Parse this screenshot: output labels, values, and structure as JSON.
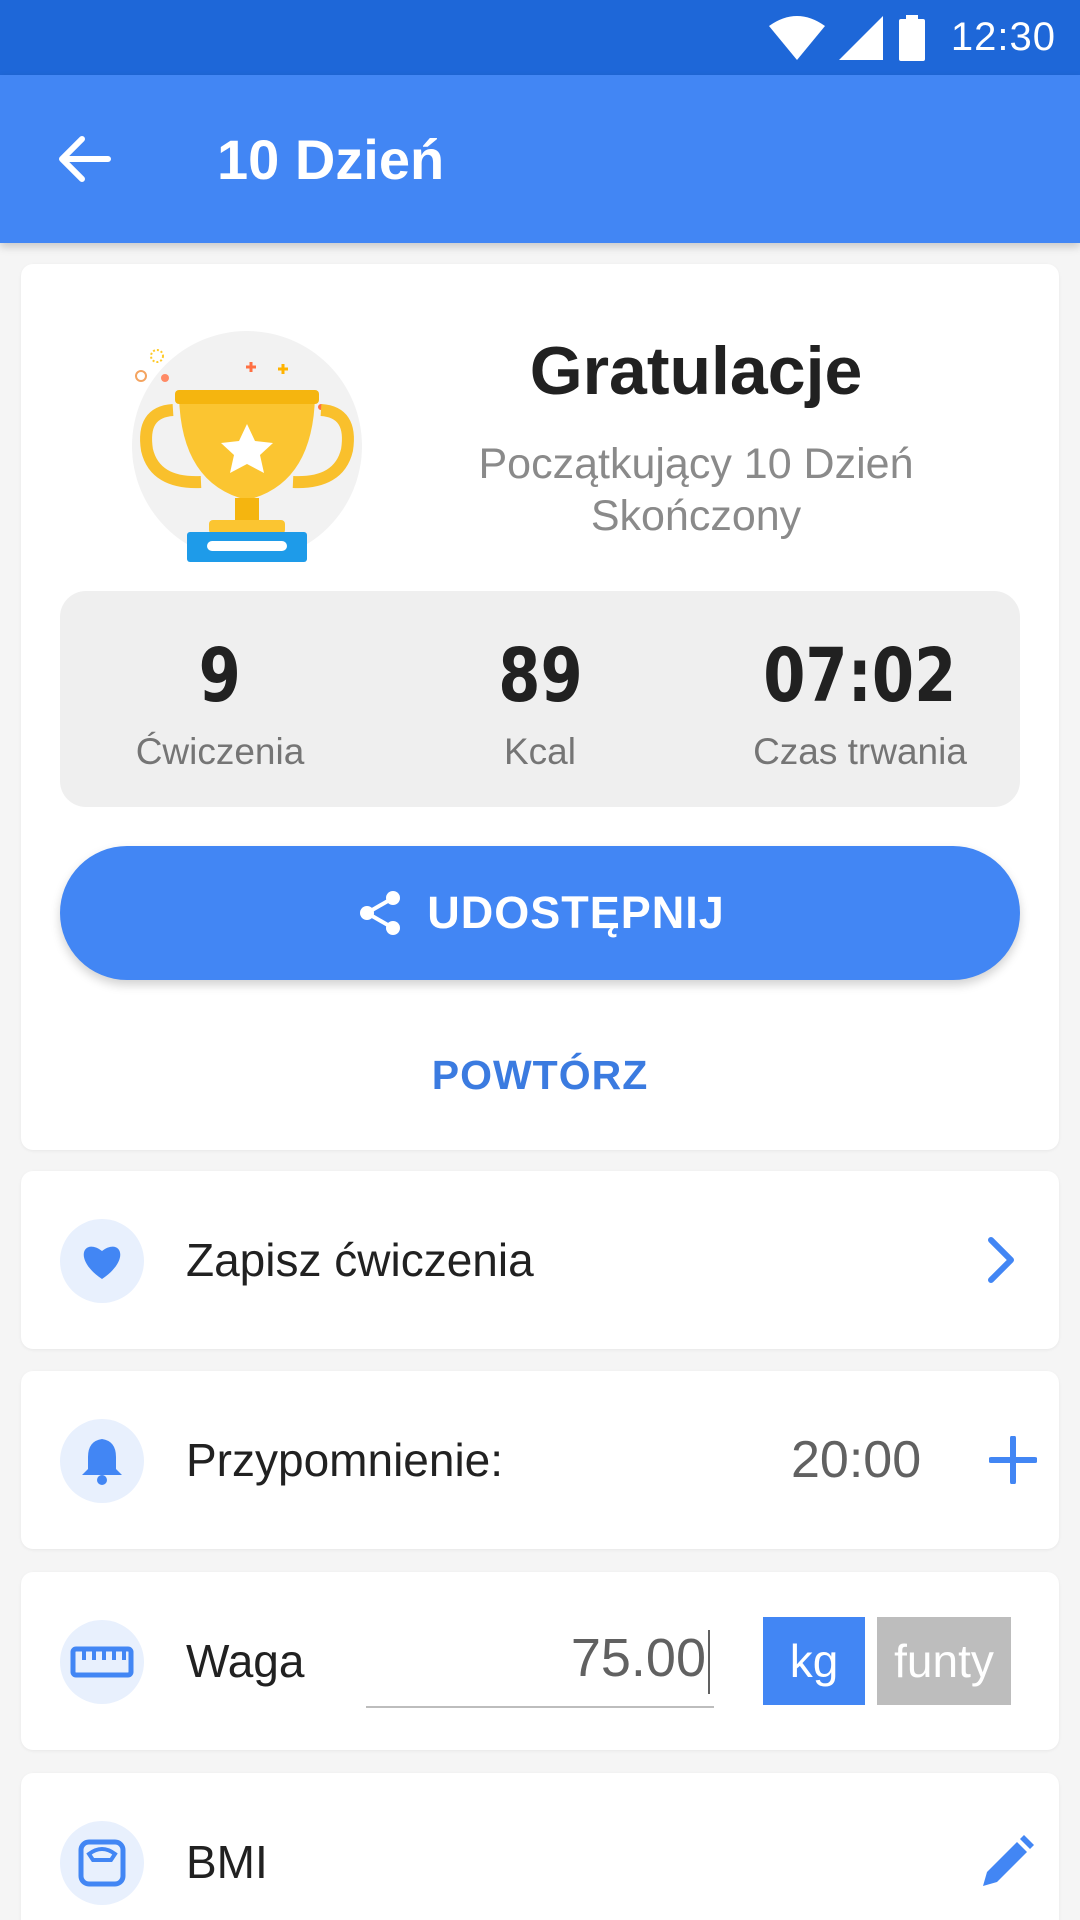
{
  "status_bar": {
    "time": "12:30",
    "icons": [
      "wifi-icon",
      "signal-icon",
      "battery-icon"
    ]
  },
  "app_bar": {
    "title": "10 Dzień",
    "back_icon": "arrow-back-icon"
  },
  "summary": {
    "trophy_icon": "trophy-icon",
    "heading": "Gratulacje",
    "subtitle_line1": "Początkujący 10 Dzień",
    "subtitle_line2": "Skończony",
    "stats": [
      {
        "value": "9",
        "label": "Ćwiczenia"
      },
      {
        "value": "89",
        "label": "Kcal"
      },
      {
        "value": "07:02",
        "label": "Czas trwania"
      }
    ],
    "share_label": "UDOSTĘPNIJ",
    "share_icon": "share-icon",
    "repeat_label": "POWTÓRZ"
  },
  "save_workout": {
    "label": "Zapisz ćwiczenia",
    "icon": "heart-icon",
    "action_icon": "chevron-right-icon"
  },
  "reminder": {
    "label": "Przypomnienie:",
    "time": "20:00",
    "icon": "bell-icon",
    "action_icon": "plus-icon"
  },
  "weight": {
    "label": "Waga",
    "value": "75.00",
    "icon": "ruler-icon",
    "unit_kg": "kg",
    "unit_lb": "funty",
    "selected_unit": "kg"
  },
  "bmi": {
    "label": "BMI",
    "icon": "scale-icon",
    "action_icon": "edit-pencil-icon"
  },
  "colors": {
    "primary": "#4286f4",
    "status_bar": "#1e67d8",
    "inactive_unit": "#bdbdbd"
  }
}
